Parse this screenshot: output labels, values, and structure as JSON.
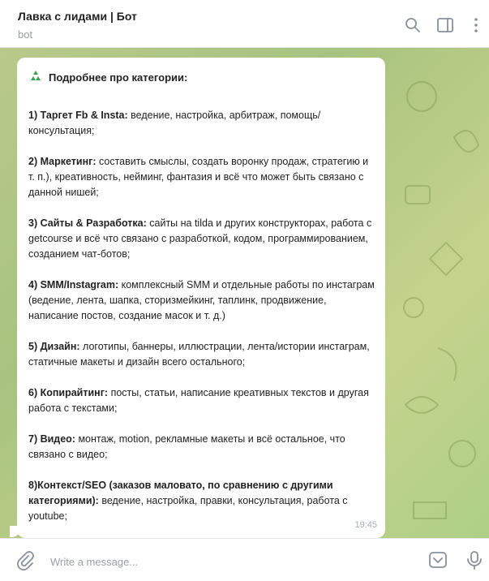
{
  "header": {
    "title": "Лавка с лидами | Бот",
    "subtitle": "bot",
    "icons": [
      "search-icon",
      "sidebar-toggle-icon",
      "more-vertical-icon"
    ]
  },
  "message": {
    "heading": "Подробнее про категории:",
    "heading_icon": "recycle-icon",
    "time": "19:45",
    "items": [
      {
        "bold": "1) Таргет Fb & Insta:",
        "text": " ведение, настройка, арбитраж, помощь/ консультация;"
      },
      {
        "bold": "2) Маркетинг:",
        "text": " составить смыслы, создать воронку продаж, стратегию и т. п.), креативность, нейминг, фантазия и всё что может быть связано с данной нишей;"
      },
      {
        "bold": "3) Сайты & Разработка:",
        "text": " сайты на tilda и других конструкторах, работа с getcourse и всё что связано с разработкой, кодом, программированием, созданием чат-ботов;"
      },
      {
        "bold": "4) SMM/Instagram:",
        "text": " комплексный SMM и отдельные работы по инстаграм (ведение, лента, шапка, сторизмейкинг, таплинк, продвижение, написание постов, создание масок и т. д.)"
      },
      {
        "bold": "5) Дизайн:",
        "text": " логотипы, баннеры, иллюстрации, лента/истории инстаграм, статичные макеты и дизайн всего остального;"
      },
      {
        "bold": "6) Копирайтинг:",
        "text": " посты, статьи, написание креативных текстов и другая работа с текстами;"
      },
      {
        "bold": "7) Видео:",
        "text": " монтаж, motion, рекламные макеты и всё остальное, что связано с видео;"
      },
      {
        "bold": "8)Контекст/SEO (заказов маловато, по сравнению с другими категориями):",
        "text": " ведение, настройка, правки, консультация, работа с youtube;"
      }
    ]
  },
  "composer": {
    "placeholder": "Write a message...",
    "icons": [
      "attach-icon",
      "bot-keyboard-icon",
      "microphone-icon"
    ]
  },
  "colors": {
    "chat_background": "#b4c985",
    "bubble": "#ffffff",
    "icon_gray": "#8a9099"
  }
}
